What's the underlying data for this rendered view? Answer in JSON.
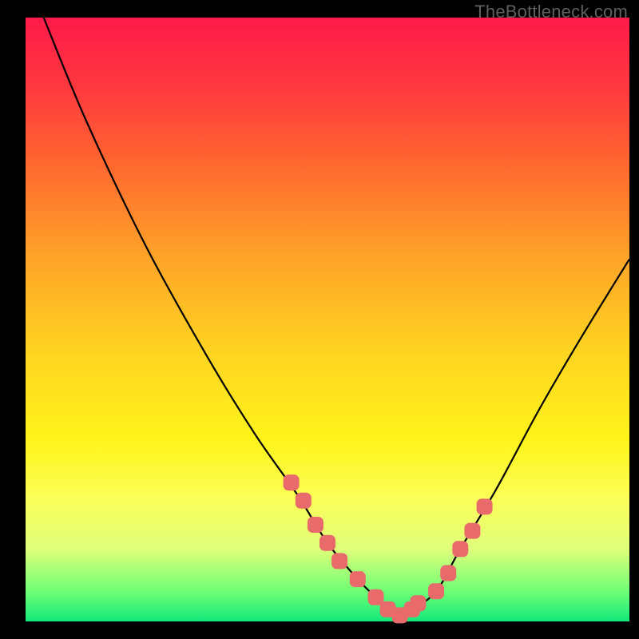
{
  "watermark": "TheBottleneck.com",
  "colors": {
    "gradient_top": "#ff1a4a",
    "gradient_mid": "#ffd321",
    "gradient_bottom": "#12e87a",
    "curve": "#000000",
    "marker": "#e86a6a",
    "background": "#000000"
  },
  "chart_data": {
    "type": "line",
    "title": "",
    "xlabel": "",
    "ylabel": "",
    "xlim": [
      0,
      100
    ],
    "ylim": [
      0,
      100
    ],
    "grid": false,
    "series": [
      {
        "name": "bottleneck-curve",
        "x": [
          3,
          10,
          20,
          30,
          38,
          45,
          50,
          55,
          58,
          60,
          62,
          64,
          68,
          72,
          78,
          85,
          92,
          100
        ],
        "y": [
          100,
          83,
          62,
          44,
          31,
          21,
          13,
          7,
          4,
          2,
          1,
          2,
          5,
          12,
          22,
          35,
          47,
          60
        ]
      }
    ],
    "highlight_points": {
      "name": "highlight-dots",
      "x": [
        44,
        46,
        48,
        50,
        52,
        55,
        58,
        60,
        62,
        64,
        65,
        68,
        70,
        72,
        74,
        76
      ],
      "y": [
        23,
        20,
        16,
        13,
        10,
        7,
        4,
        2,
        1,
        2,
        3,
        5,
        8,
        12,
        15,
        19
      ]
    }
  }
}
